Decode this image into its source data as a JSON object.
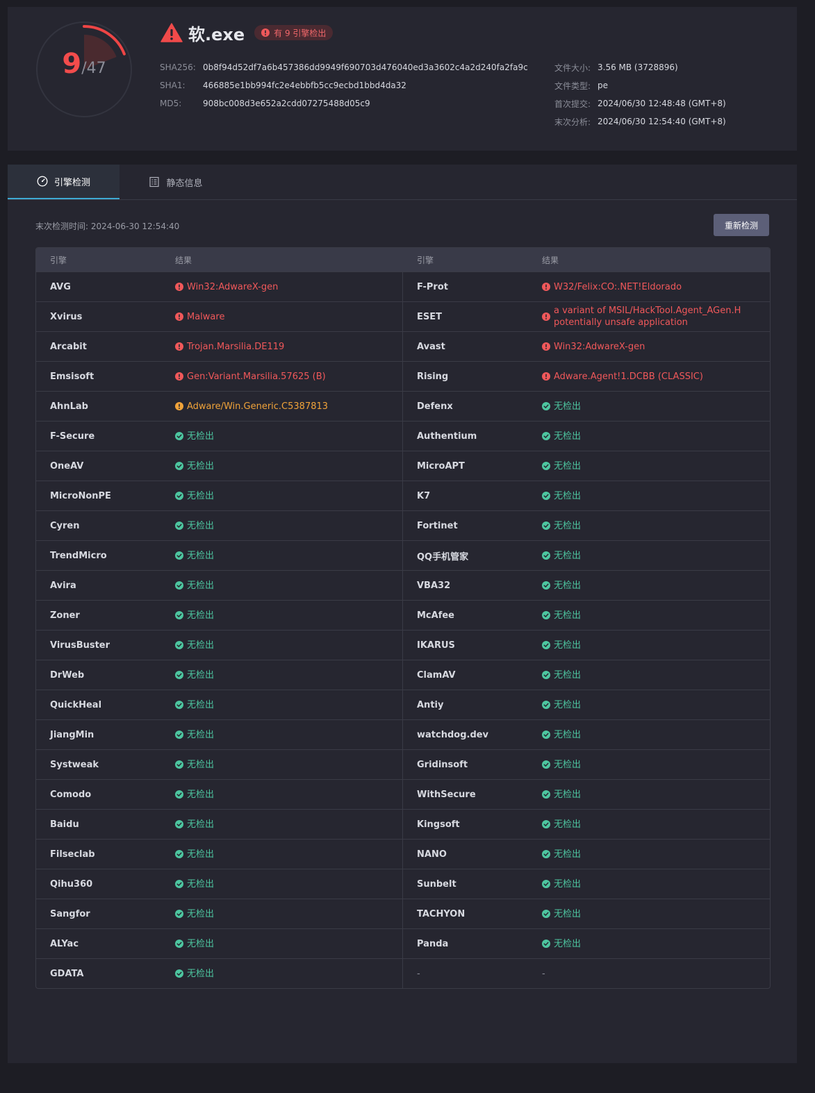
{
  "summary": {
    "detected": "9",
    "total": "/47",
    "detected_fraction": 0.1915,
    "file_name": "软.exe",
    "badge": "有 9 引擎检出",
    "hashes": [
      {
        "label": "SHA256:",
        "value": "0b8f94d52df7a6b457386dd9949f690703d476040ed3a3602c4a2d240fa2fa9c"
      },
      {
        "label": "SHA1:",
        "value": "466885e1bb994fc2e4ebbfb5cc9ecbd1bbd4da32"
      },
      {
        "label": "MD5:",
        "value": "908bc008d3e652a2cdd07275488d05c9"
      }
    ],
    "file_info": [
      {
        "label": "文件大小:",
        "value": "3.56 MB (3728896)"
      },
      {
        "label": "文件类型:",
        "value": "pe"
      },
      {
        "label": "首次提交:",
        "value": "2024/06/30 12:48:48 (GMT+8)"
      },
      {
        "label": "末次分析:",
        "value": "2024/06/30 12:54:40 (GMT+8)"
      }
    ]
  },
  "tabs": [
    {
      "label": "引擎检测",
      "icon": "gauge-icon",
      "active": true
    },
    {
      "label": "静态信息",
      "icon": "document-icon",
      "active": false
    }
  ],
  "last_check": "末次检测时间: 2024-06-30 12:54:40",
  "recheck_label": "重新检测",
  "table": {
    "headers": [
      "引擎",
      "结果",
      "引擎",
      "结果"
    ],
    "rows": [
      [
        {
          "engine": "AVG",
          "result": "Win32:AdwareX-gen",
          "status": "danger"
        },
        {
          "engine": "F-Prot",
          "result": "W32/Felix:CO:.NET!Eldorado",
          "status": "danger"
        }
      ],
      [
        {
          "engine": "Xvirus",
          "result": "Malware",
          "status": "danger"
        },
        {
          "engine": "ESET",
          "result": "a variant of MSIL/HackTool.Agent_AGen.H potentially unsafe application",
          "status": "danger"
        }
      ],
      [
        {
          "engine": "Arcabit",
          "result": "Trojan.Marsilia.DE119",
          "status": "danger"
        },
        {
          "engine": "Avast",
          "result": "Win32:AdwareX-gen",
          "status": "danger"
        }
      ],
      [
        {
          "engine": "Emsisoft",
          "result": "Gen:Variant.Marsilia.57625 (B)",
          "status": "danger"
        },
        {
          "engine": "Rising",
          "result": "Adware.Agent!1.DCBB (CLASSIC)",
          "status": "danger"
        }
      ],
      [
        {
          "engine": "AhnLab",
          "result": "Adware/Win.Generic.C5387813",
          "status": "warning"
        },
        {
          "engine": "Defenx",
          "result": "无检出",
          "status": "clean"
        }
      ],
      [
        {
          "engine": "F-Secure",
          "result": "无检出",
          "status": "clean"
        },
        {
          "engine": "Authentium",
          "result": "无检出",
          "status": "clean"
        }
      ],
      [
        {
          "engine": "OneAV",
          "result": "无检出",
          "status": "clean"
        },
        {
          "engine": "MicroAPT",
          "result": "无检出",
          "status": "clean"
        }
      ],
      [
        {
          "engine": "MicroNonPE",
          "result": "无检出",
          "status": "clean"
        },
        {
          "engine": "K7",
          "result": "无检出",
          "status": "clean"
        }
      ],
      [
        {
          "engine": "Cyren",
          "result": "无检出",
          "status": "clean"
        },
        {
          "engine": "Fortinet",
          "result": "无检出",
          "status": "clean"
        }
      ],
      [
        {
          "engine": "TrendMicro",
          "result": "无检出",
          "status": "clean"
        },
        {
          "engine": "QQ手机管家",
          "result": "无检出",
          "status": "clean"
        }
      ],
      [
        {
          "engine": "Avira",
          "result": "无检出",
          "status": "clean"
        },
        {
          "engine": "VBA32",
          "result": "无检出",
          "status": "clean"
        }
      ],
      [
        {
          "engine": "Zoner",
          "result": "无检出",
          "status": "clean"
        },
        {
          "engine": "McAfee",
          "result": "无检出",
          "status": "clean"
        }
      ],
      [
        {
          "engine": "VirusBuster",
          "result": "无检出",
          "status": "clean"
        },
        {
          "engine": "IKARUS",
          "result": "无检出",
          "status": "clean"
        }
      ],
      [
        {
          "engine": "DrWeb",
          "result": "无检出",
          "status": "clean"
        },
        {
          "engine": "ClamAV",
          "result": "无检出",
          "status": "clean"
        }
      ],
      [
        {
          "engine": "QuickHeal",
          "result": "无检出",
          "status": "clean"
        },
        {
          "engine": "Antiy",
          "result": "无检出",
          "status": "clean"
        }
      ],
      [
        {
          "engine": "JiangMin",
          "result": "无检出",
          "status": "clean"
        },
        {
          "engine": "watchdog.dev",
          "result": "无检出",
          "status": "clean"
        }
      ],
      [
        {
          "engine": "Systweak",
          "result": "无检出",
          "status": "clean"
        },
        {
          "engine": "Gridinsoft",
          "result": "无检出",
          "status": "clean"
        }
      ],
      [
        {
          "engine": "Comodo",
          "result": "无检出",
          "status": "clean"
        },
        {
          "engine": "WithSecure",
          "result": "无检出",
          "status": "clean"
        }
      ],
      [
        {
          "engine": "Baidu",
          "result": "无检出",
          "status": "clean"
        },
        {
          "engine": "Kingsoft",
          "result": "无检出",
          "status": "clean"
        }
      ],
      [
        {
          "engine": "Filseclab",
          "result": "无检出",
          "status": "clean"
        },
        {
          "engine": "NANO",
          "result": "无检出",
          "status": "clean"
        }
      ],
      [
        {
          "engine": "Qihu360",
          "result": "无检出",
          "status": "clean"
        },
        {
          "engine": "Sunbelt",
          "result": "无检出",
          "status": "clean"
        }
      ],
      [
        {
          "engine": "Sangfor",
          "result": "无检出",
          "status": "clean"
        },
        {
          "engine": "TACHYON",
          "result": "无检出",
          "status": "clean"
        }
      ],
      [
        {
          "engine": "ALYac",
          "result": "无检出",
          "status": "clean"
        },
        {
          "engine": "Panda",
          "result": "无检出",
          "status": "clean"
        }
      ],
      [
        {
          "engine": "GDATA",
          "result": "无检出",
          "status": "clean"
        },
        {
          "engine": "-",
          "result": "-",
          "status": "none"
        }
      ]
    ]
  },
  "colors": {
    "danger": "#f0585a",
    "warning": "#f0a33a",
    "clean": "#4dc6a0",
    "accent": "#3eaad4"
  }
}
